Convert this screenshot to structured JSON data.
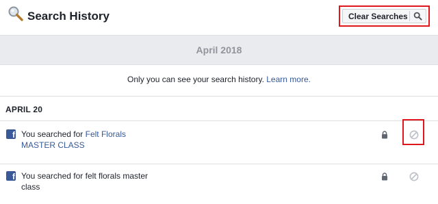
{
  "header": {
    "title": "Search History",
    "clear_label": "Clear Searches"
  },
  "month": "April 2018",
  "notice": {
    "text": "Only you can see your search history.",
    "link": "Learn more."
  },
  "day": "APRIL 20",
  "items": [
    {
      "prefix": "You searched for",
      "query": "Felt Florals MASTER CLASS",
      "query_is_link": true
    },
    {
      "prefix": "You searched for",
      "query": "felt florals master class",
      "query_is_link": false
    }
  ],
  "icons": {
    "header": "magnifying-glass-icon",
    "clear": "search-icon",
    "app": "facebook-icon",
    "privacy": "lock-icon",
    "hide": "hide-circle-slash-icon"
  },
  "colors": {
    "link": "#365899",
    "highlight": "#e0161d",
    "facebook": "#3b5998"
  }
}
